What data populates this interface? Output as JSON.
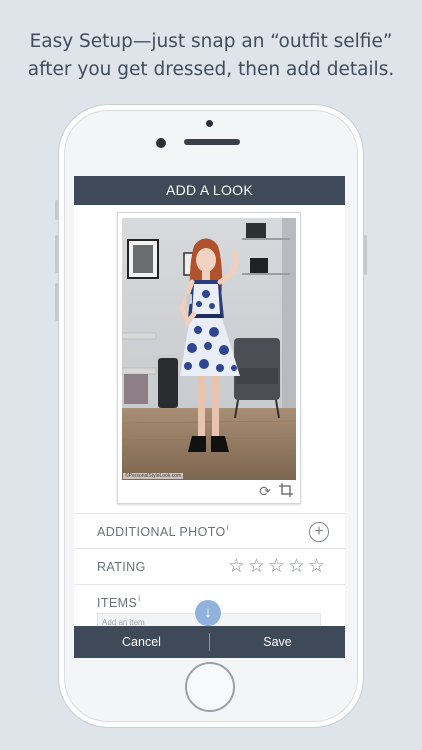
{
  "caption": {
    "line1": "Easy Setup—just snap an “outfit selfie”",
    "line2": "after you get dressed, then add details."
  },
  "screen": {
    "title": "ADD A LOOK",
    "photo_credit": "©PersonalStyleLook.com",
    "rows": {
      "additional_photo": {
        "label": "ADDITIONAL PHOTO",
        "info": "i"
      },
      "rating": {
        "label": "RATING",
        "stars": 0,
        "max_stars": 5,
        "star_glyph": "☆"
      },
      "items": {
        "label": "ITEMS",
        "info": "i",
        "input_placeholder": "Add an item"
      }
    },
    "buttons": {
      "cancel": "Cancel",
      "save": "Save"
    }
  },
  "icons": {
    "rotate": "rotate-icon",
    "crop": "crop-icon",
    "add": "plus-circle-icon",
    "scroll_down": "arrow-down-icon"
  },
  "colors": {
    "background": "#dfe4ea",
    "bar": "#3f4a59",
    "accent": "#8fb3dc",
    "text_muted": "#6b717b"
  }
}
